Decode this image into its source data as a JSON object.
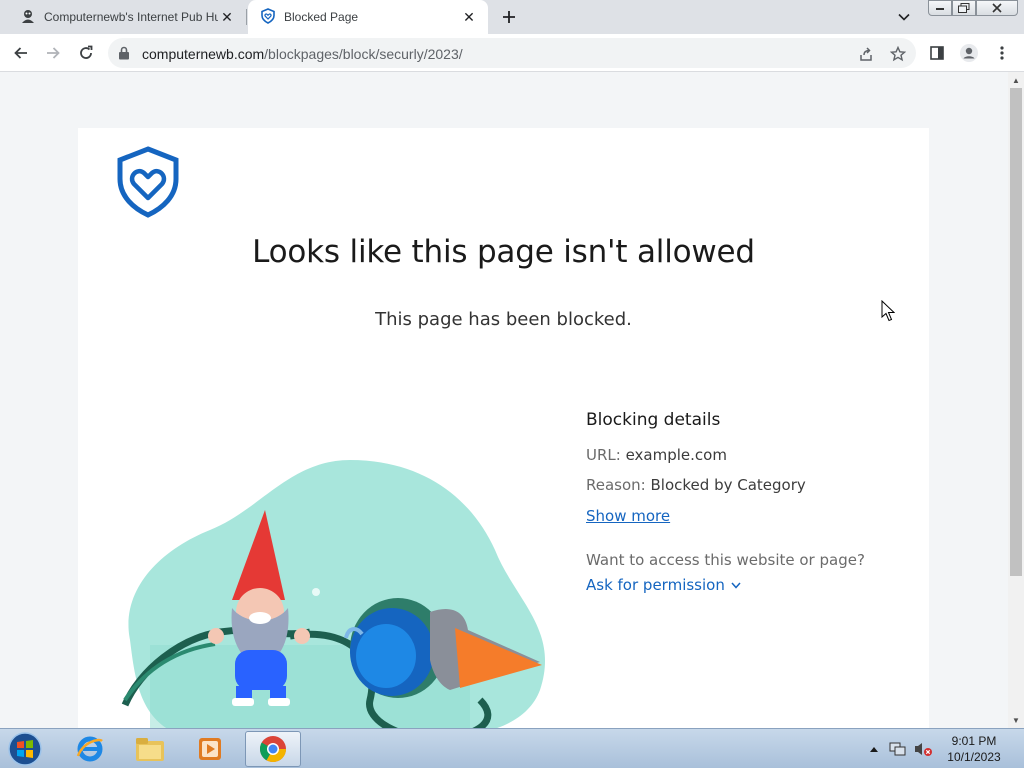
{
  "browser": {
    "tabs": [
      {
        "title": "Computernewb's Internet Pub Hub",
        "active": false
      },
      {
        "title": "Blocked Page",
        "active": true
      }
    ],
    "address_bar": {
      "host": "computernewb.com",
      "path": "/blockpages/block/securly/2023/"
    }
  },
  "page": {
    "heading": "Looks like this page isn't allowed",
    "subheading": "This page has been blocked.",
    "details": {
      "title": "Blocking details",
      "url_label": "URL:",
      "url_value": "example.com",
      "reason_label": "Reason:",
      "reason_value": "Blocked by Category",
      "show_more": "Show more",
      "question": "Want to access this website or page?",
      "ask_permission": "Ask for permission"
    }
  },
  "taskbar": {
    "time": "9:01 PM",
    "date": "10/1/2023"
  },
  "colors": {
    "accent_blue": "#1565c0",
    "blob": "#a8e6dc"
  }
}
